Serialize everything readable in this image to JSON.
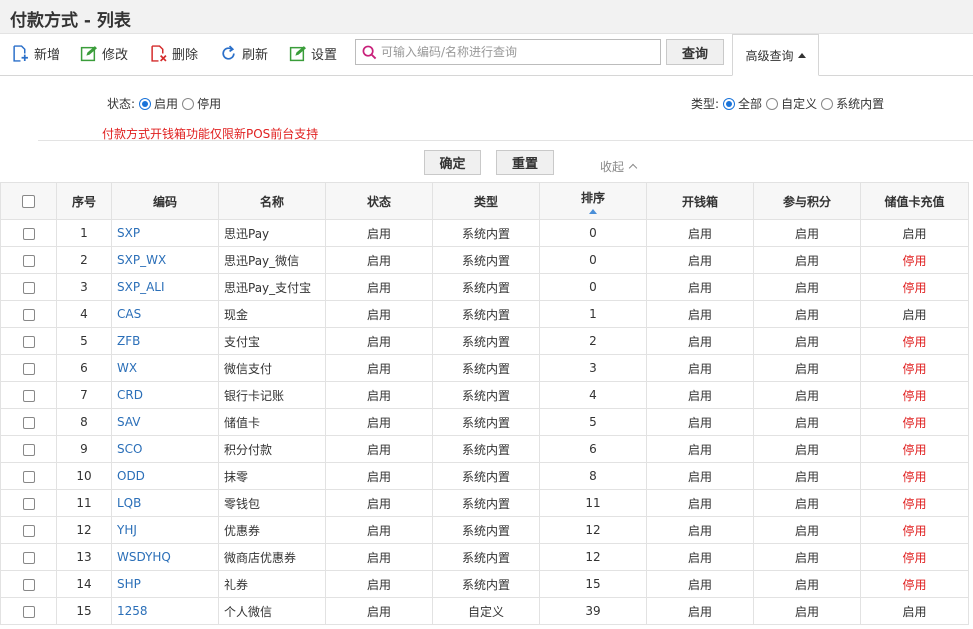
{
  "page": {
    "title": "付款方式 - 列表"
  },
  "toolbar": {
    "add_label": "新增",
    "edit_label": "修改",
    "delete_label": "删除",
    "refresh_label": "刷新",
    "settings_label": "设置",
    "search_placeholder": "可输入编码/名称进行查询",
    "query_label": "查询",
    "advanced_label": "高级查询"
  },
  "filters": {
    "status": {
      "label": "状态:",
      "options": [
        "启用",
        "停用"
      ],
      "selected": "启用"
    },
    "type": {
      "label": "类型:",
      "options": [
        "全部",
        "自定义",
        "系统内置"
      ],
      "selected": "全部"
    },
    "notice": "付款方式开钱箱功能仅限新POS前台支持",
    "confirm_label": "确定",
    "reset_label": "重置",
    "collapse_label": "收起"
  },
  "colors": {
    "accent": "#1a73d9",
    "code_link": "#2b6fb8",
    "disabled_red": "#e02020"
  },
  "table": {
    "columns": [
      "序号",
      "编码",
      "名称",
      "状态",
      "类型",
      "排序",
      "开钱箱",
      "参与积分",
      "储值卡充值"
    ],
    "rows": [
      [
        "1",
        "SXP",
        "思迅Pay",
        "启用",
        "系统内置",
        "0",
        "启用",
        "启用",
        "启用"
      ],
      [
        "2",
        "SXP_WX",
        "思迅Pay_微信",
        "启用",
        "系统内置",
        "0",
        "启用",
        "启用",
        "停用"
      ],
      [
        "3",
        "SXP_ALI",
        "思迅Pay_支付宝",
        "启用",
        "系统内置",
        "0",
        "启用",
        "启用",
        "停用"
      ],
      [
        "4",
        "CAS",
        "现金",
        "启用",
        "系统内置",
        "1",
        "启用",
        "启用",
        "启用"
      ],
      [
        "5",
        "ZFB",
        "支付宝",
        "启用",
        "系统内置",
        "2",
        "启用",
        "启用",
        "停用"
      ],
      [
        "6",
        "WX",
        "微信支付",
        "启用",
        "系统内置",
        "3",
        "启用",
        "启用",
        "停用"
      ],
      [
        "7",
        "CRD",
        "银行卡记账",
        "启用",
        "系统内置",
        "4",
        "启用",
        "启用",
        "停用"
      ],
      [
        "8",
        "SAV",
        "储值卡",
        "启用",
        "系统内置",
        "5",
        "启用",
        "启用",
        "停用"
      ],
      [
        "9",
        "SCO",
        "积分付款",
        "启用",
        "系统内置",
        "6",
        "启用",
        "启用",
        "停用"
      ],
      [
        "10",
        "ODD",
        "抹零",
        "启用",
        "系统内置",
        "8",
        "启用",
        "启用",
        "停用"
      ],
      [
        "11",
        "LQB",
        "零钱包",
        "启用",
        "系统内置",
        "11",
        "启用",
        "启用",
        "停用"
      ],
      [
        "12",
        "YHJ",
        "优惠券",
        "启用",
        "系统内置",
        "12",
        "启用",
        "启用",
        "停用"
      ],
      [
        "13",
        "WSDYHQ",
        "微商店优惠券",
        "启用",
        "系统内置",
        "12",
        "启用",
        "启用",
        "停用"
      ],
      [
        "14",
        "SHP",
        "礼券",
        "启用",
        "系统内置",
        "15",
        "启用",
        "启用",
        "停用"
      ],
      [
        "15",
        "1258",
        "个人微信",
        "启用",
        "自定义",
        "39",
        "启用",
        "启用",
        "启用"
      ]
    ]
  }
}
